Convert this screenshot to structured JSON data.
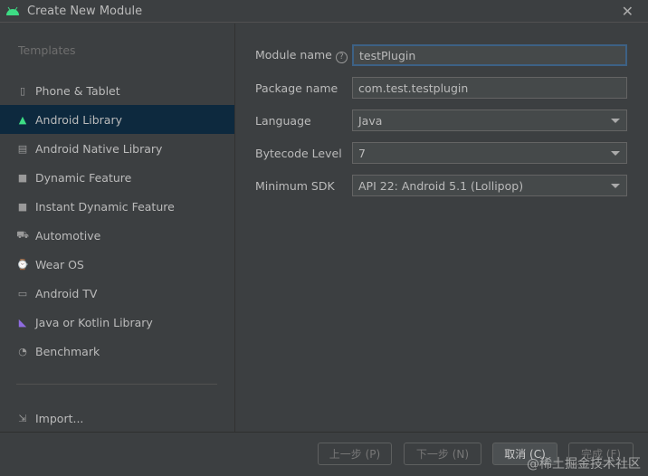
{
  "window": {
    "title": "Create New Module"
  },
  "sidebar": {
    "heading": "Templates",
    "items": [
      {
        "label": "Phone & Tablet",
        "icon": "phone-tablet-icon"
      },
      {
        "label": "Android Library",
        "icon": "android-icon",
        "selected": true
      },
      {
        "label": "Android Native Library",
        "icon": "chip-icon"
      },
      {
        "label": "Dynamic Feature",
        "icon": "folder-icon"
      },
      {
        "label": "Instant Dynamic Feature",
        "icon": "folder-icon"
      },
      {
        "label": "Automotive",
        "icon": "car-icon"
      },
      {
        "label": "Wear OS",
        "icon": "watch-icon"
      },
      {
        "label": "Android TV",
        "icon": "tv-icon"
      },
      {
        "label": "Java or Kotlin Library",
        "icon": "kotlin-icon"
      },
      {
        "label": "Benchmark",
        "icon": "gauge-icon"
      }
    ],
    "import": "Import..."
  },
  "form": {
    "module_name_label": "Module name",
    "module_name": "testPlugin",
    "package_label": "Package name",
    "package": "com.test.testplugin",
    "language_label": "Language",
    "language": "Java",
    "bytecode_label": "Bytecode Level",
    "bytecode": "7",
    "sdk_label": "Minimum SDK",
    "sdk": "API 22: Android 5.1 (Lollipop)"
  },
  "buttons": {
    "prev": "上一步 (P)",
    "next": "下一步 (N)",
    "cancel": "取消 (C)",
    "finish": "完成 (F)"
  },
  "watermark": "@稀土掘金技术社区"
}
